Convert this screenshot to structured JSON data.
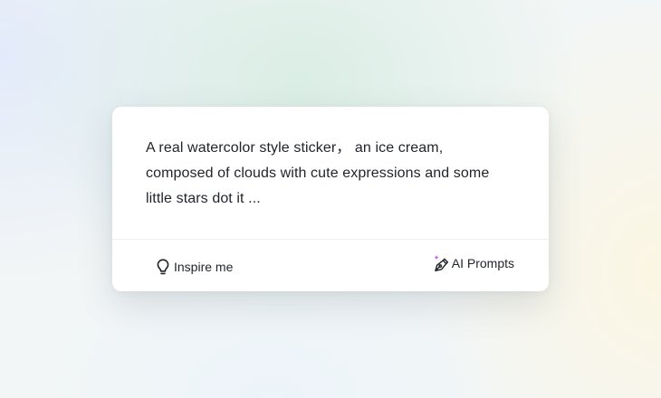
{
  "prompt": {
    "lines": [
      "A real watercolor style sticker， an ice cream,",
      "composed of clouds with cute expressions and some",
      "little stars dot it ..."
    ]
  },
  "footer": {
    "inspire_label": "Inspire me",
    "inspire_icon": "lightbulb-icon",
    "ai_prompts_label": "AI Prompts",
    "ai_prompts_icon": "pen-sparkle-icon"
  },
  "colors": {
    "text": "#1f2328",
    "sparkle": "#d946ef",
    "card_background": "#ffffff"
  }
}
